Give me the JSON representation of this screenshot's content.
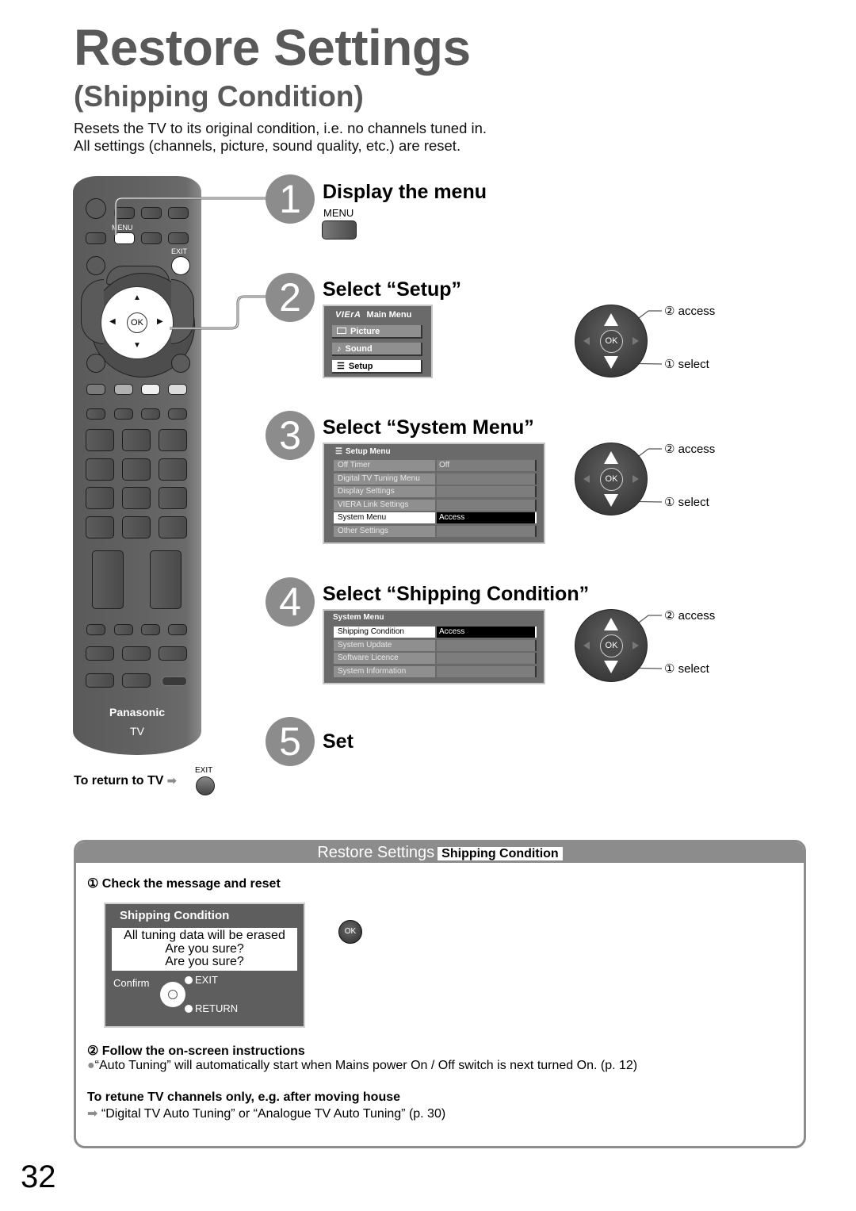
{
  "header": {
    "title": "Restore Settings",
    "subtitle": "(Shipping Condition)",
    "intro_line1": "Resets the TV to its original condition, i.e. no channels tuned in.",
    "intro_line2": "All settings (channels, picture, sound quality, etc.) are reset."
  },
  "remote": {
    "menu_label": "MENU",
    "exit_label": "EXIT",
    "ok_label": "OK",
    "brand": "Panasonic",
    "model": "TV"
  },
  "steps": [
    {
      "number": "1",
      "title": "Display the menu",
      "key_label": "MENU"
    },
    {
      "number": "2",
      "title": "Select “Setup”"
    },
    {
      "number": "3",
      "title": "Select “System Menu”"
    },
    {
      "number": "4",
      "title": "Select “Shipping Condition”"
    },
    {
      "number": "5",
      "title": "Set"
    }
  ],
  "main_menu": {
    "brand": "VIErA",
    "title": "Main Menu",
    "items": [
      {
        "icon": "picture-icon",
        "label": "Picture",
        "selected": false
      },
      {
        "icon": "note-icon",
        "label": "Sound",
        "selected": false
      },
      {
        "icon": "list-icon",
        "label": "Setup",
        "selected": true
      }
    ]
  },
  "setup_menu": {
    "title": "Setup Menu",
    "rows": [
      {
        "label": "Off Timer",
        "value": "Off"
      },
      {
        "label": "Digital TV Tuning Menu",
        "value": ""
      },
      {
        "label": "Display Settings",
        "value": ""
      },
      {
        "label": "VIERA Link Settings",
        "value": ""
      },
      {
        "label": "System Menu",
        "value": "Access",
        "selected": true
      },
      {
        "label": "Other Settings",
        "value": ""
      }
    ]
  },
  "system_menu": {
    "title": "System Menu",
    "rows": [
      {
        "label": "Shipping Condition",
        "value": "Access",
        "selected": true
      },
      {
        "label": "System Update",
        "value": ""
      },
      {
        "label": "Software Licence",
        "value": ""
      },
      {
        "label": "System Information",
        "value": ""
      }
    ]
  },
  "navpad": {
    "ok_label": "OK",
    "access_label": "② access",
    "select_label": "① select"
  },
  "return_to_tv": {
    "label": "To return to TV",
    "exit_label": "EXIT"
  },
  "box": {
    "title": "Restore Settings",
    "chip": "Shipping Condition",
    "step1": "① Check the message and reset",
    "dialog": {
      "title": "Shipping Condition",
      "line1": "All tuning data will be erased",
      "line2": "Are you sure?",
      "line3": "Are you sure?",
      "confirm": "Confirm",
      "exit": "EXIT",
      "return": "RETURN"
    },
    "ok_label": "OK",
    "step2": "② Follow the on-screen instructions",
    "note": "“Auto Tuning” will automatically start when Mains power On / Off switch is next turned On. (p. 12)",
    "retune_heading": "To retune TV channels only, e.g. after moving house",
    "retune_ref": "“Digital TV Auto Tuning” or “Analogue TV Auto Tuning” (p. 30)"
  },
  "page_number": "32"
}
